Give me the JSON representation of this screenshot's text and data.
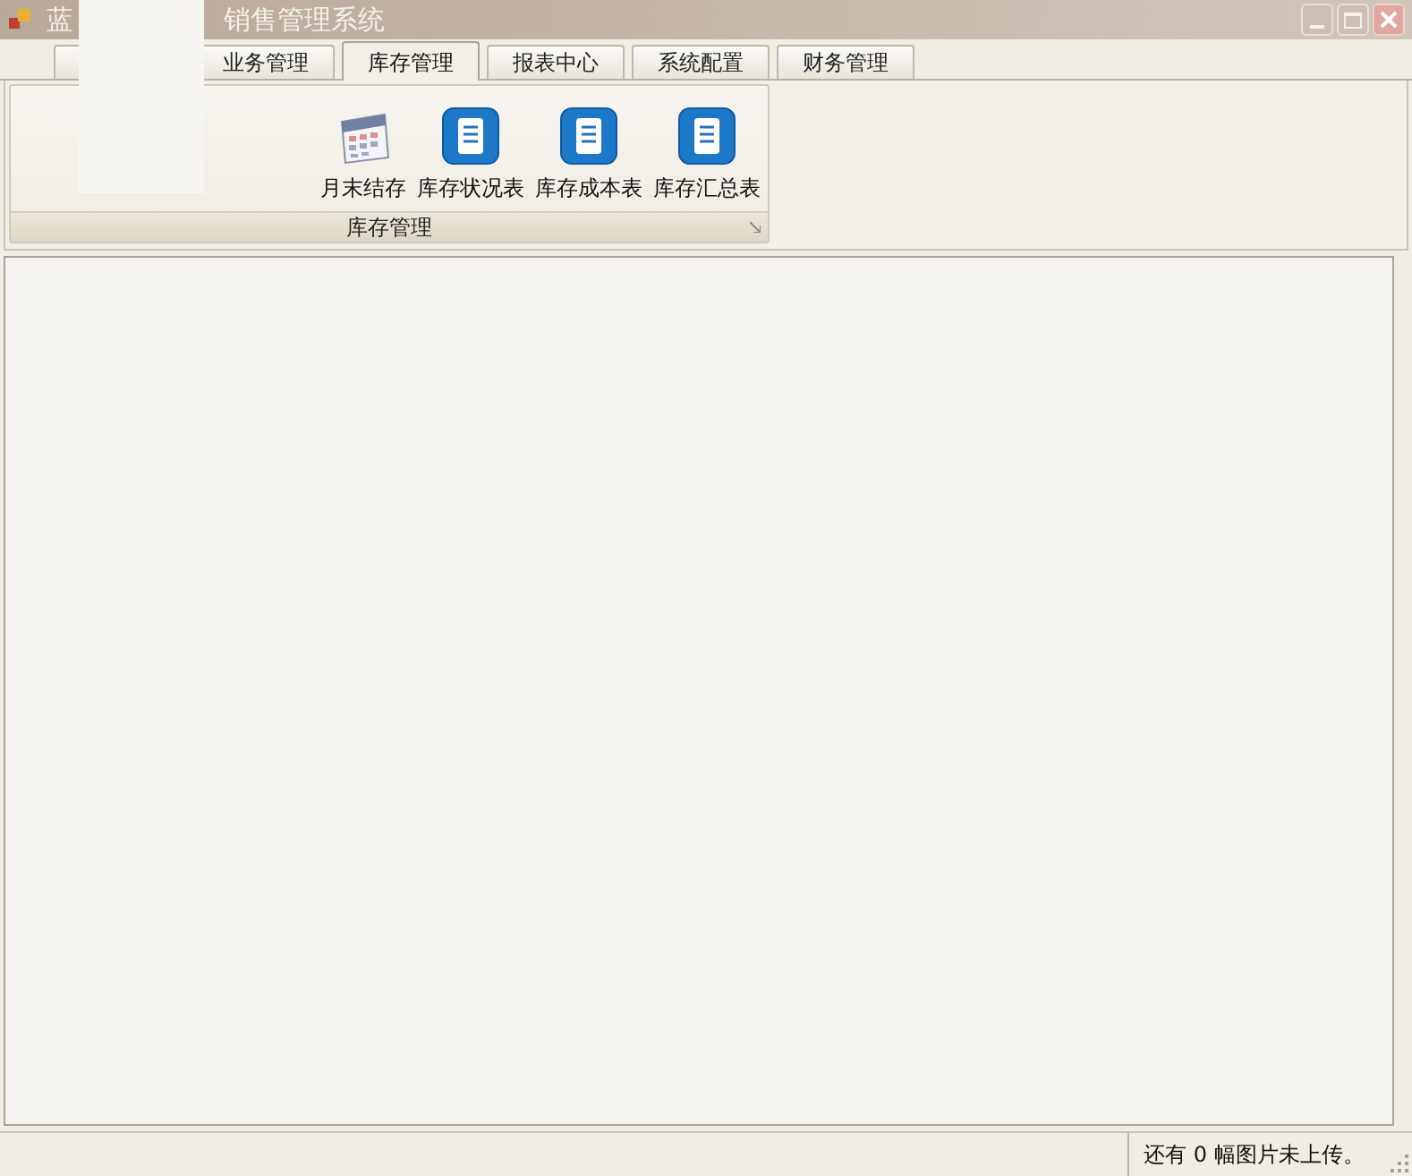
{
  "window": {
    "title_parts": [
      "蓝",
      "销售管理系统"
    ]
  },
  "tabs": [
    {
      "selected": false
    },
    {
      "label": "业务管理",
      "selected": false
    },
    {
      "label": "库存管理",
      "selected": true
    },
    {
      "label": "报表中心",
      "selected": false
    },
    {
      "label": "系统配置",
      "selected": false
    },
    {
      "label": "财务管理",
      "selected": false
    }
  ],
  "ribbon_group": {
    "label": "库存管理",
    "items": [
      {
        "label": "月末结存",
        "kind": "calendar"
      },
      {
        "label": "库存状况表",
        "kind": "report"
      },
      {
        "label": "库存成本表",
        "kind": "report"
      },
      {
        "label": "库存汇总表",
        "kind": "report"
      }
    ]
  },
  "status_bar": {
    "text": "还有 0 幅图片未上传。"
  }
}
